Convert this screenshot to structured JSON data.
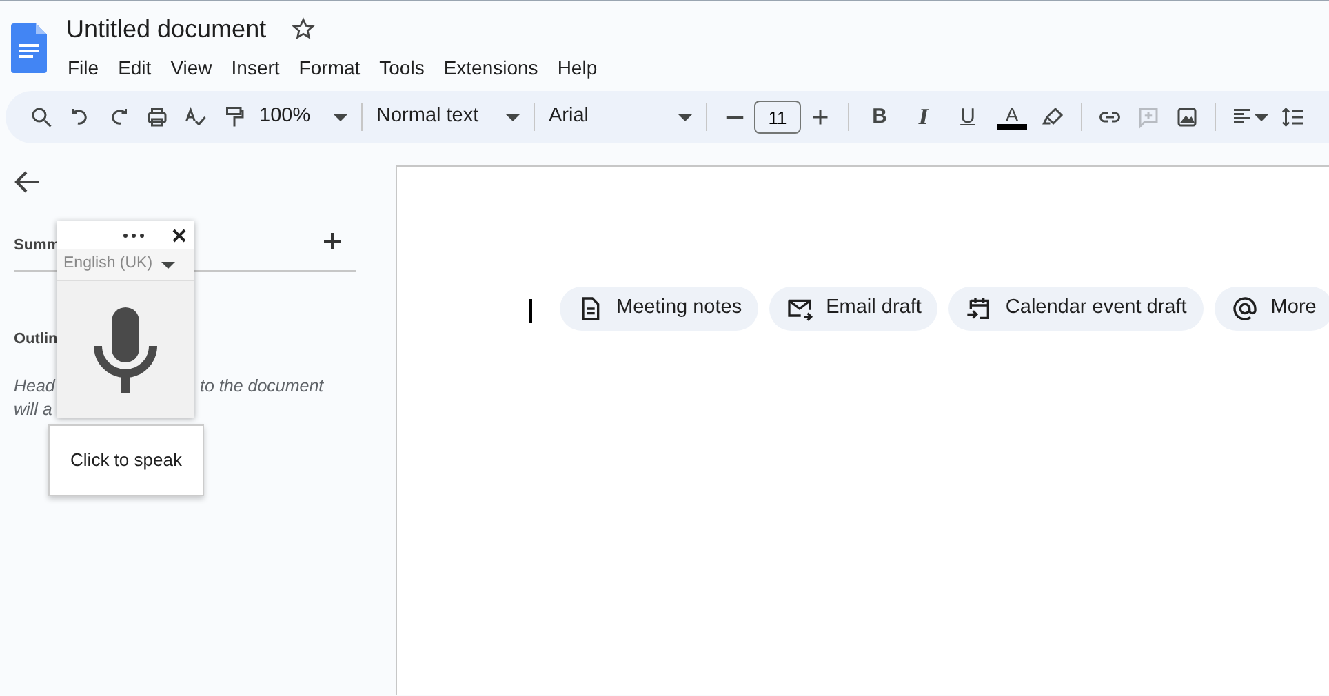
{
  "document": {
    "title": "Untitled document",
    "starred": false
  },
  "menu": [
    "File",
    "Edit",
    "View",
    "Insert",
    "Format",
    "Tools",
    "Extensions",
    "Help"
  ],
  "toolbar": {
    "zoom": "100%",
    "style": "Normal text",
    "font": "Arial",
    "font_size": "11",
    "bold": "B",
    "italic": "I",
    "underline": "U",
    "text_color": {
      "label": "A",
      "color": "#000000"
    },
    "comment_disabled": true
  },
  "sidebar": {
    "summary_heading": "Summ",
    "outline_heading": "Outlin",
    "hint_lines": [
      [
        "Head",
        "to the document"
      ],
      [
        "will a"
      ]
    ]
  },
  "voice_typing": {
    "language": "English (UK)",
    "tooltip": "Click to speak"
  },
  "chips": [
    {
      "label": "Meeting notes"
    },
    {
      "label": "Email draft"
    },
    {
      "label": "Calendar event draft"
    },
    {
      "label": "More"
    }
  ]
}
